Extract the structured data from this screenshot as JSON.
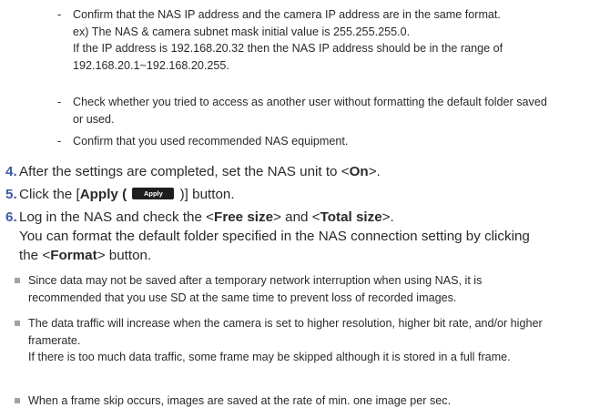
{
  "dash_items": [
    [
      "Confirm that the NAS IP address and the camera IP address are in the same format.",
      "ex) The NAS & camera subnet mask initial value is 255.255.255.0.",
      "If the IP address is 192.168.20.32 then the NAS IP address should be in the range of",
      "192.168.20.1~192.168.20.255."
    ],
    [
      "Check whether you tried to access as another user without formatting the default folder saved",
      "or used."
    ],
    [
      "Confirm that you used recommended NAS equipment."
    ]
  ],
  "dash_mark": "-",
  "steps": {
    "s4": {
      "num": "4.",
      "pre": "After the settings are completed, set the NAS unit to <",
      "bold": "On",
      "post": ">."
    },
    "s5": {
      "num": "5.",
      "pre": "Click the [",
      "bold": "Apply (",
      "pill": "Apply",
      "post": ")] button."
    },
    "s6": {
      "num": "6.",
      "line1_pre": "Log in the NAS and check the <",
      "line1_b1": "Free size",
      "line1_mid": "> and <",
      "line1_b2": "Total size",
      "line1_post": ">.",
      "line2": "You can format the default folder specified in the NAS connection setting by clicking",
      "line3_pre": "the <",
      "line3_bold": "Format",
      "line3_post": "> button."
    }
  },
  "notes": [
    [
      "Since data may not be saved after a temporary network interruption when using NAS, it is",
      "recommended that you use SD at the same time to prevent loss of recorded images."
    ],
    [
      "The data traffic will increase when the camera is set to higher resolution, higher bit rate, and/or higher",
      "framerate.",
      "If there is too much data traffic, some frame may be skipped although it is stored in a full frame."
    ],
    [
      "When a frame skip occurs, images are saved at the rate of min. one image per sec."
    ]
  ],
  "colors": {
    "step_number": "#3f5aa6",
    "text": "#2a2a2a",
    "bullet": "#a3a3a3",
    "pill_bg": "#1e1e1e"
  }
}
